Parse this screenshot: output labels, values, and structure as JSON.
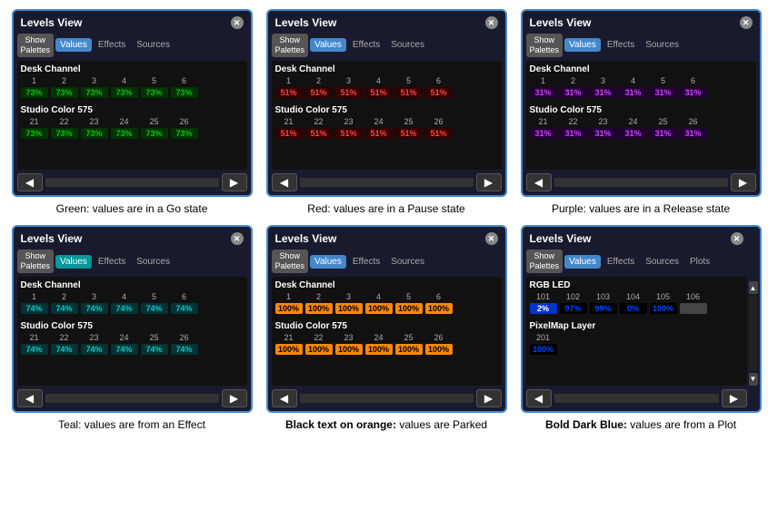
{
  "panels": [
    {
      "id": "green",
      "title": "Levels View",
      "tabs": [
        "Show Palettes",
        "Values",
        "Effects",
        "Sources"
      ],
      "activeTab": "Values",
      "sections": [
        {
          "label": "Desk Channel",
          "channels": [
            1,
            2,
            3,
            4,
            5,
            6
          ],
          "values": [
            "73%",
            "73%",
            "73%",
            "73%",
            "73%",
            "73%"
          ],
          "style": "green"
        },
        {
          "label": "Studio Color 575",
          "channels": [
            21,
            22,
            23,
            24,
            25,
            26
          ],
          "values": [
            "73%",
            "73%",
            "73%",
            "73%",
            "73%",
            "73%"
          ],
          "style": "green"
        }
      ],
      "caption": "Green: values are in a Go state",
      "captionBold": false
    },
    {
      "id": "red",
      "title": "Levels View",
      "tabs": [
        "Show Palettes",
        "Values",
        "Effects",
        "Sources"
      ],
      "activeTab": "Values",
      "sections": [
        {
          "label": "Desk Channel",
          "channels": [
            1,
            2,
            3,
            4,
            5,
            6
          ],
          "values": [
            "51%",
            "51%",
            "51%",
            "51%",
            "51%",
            "51%"
          ],
          "style": "red"
        },
        {
          "label": "Studio Color 575",
          "channels": [
            21,
            22,
            23,
            24,
            25,
            26
          ],
          "values": [
            "51%",
            "51%",
            "51%",
            "51%",
            "51%",
            "51%"
          ],
          "style": "red"
        }
      ],
      "caption": "Red: values are in a Pause state",
      "captionBold": false
    },
    {
      "id": "purple",
      "title": "Levels View",
      "tabs": [
        "Show Palettes",
        "Values",
        "Effects",
        "Sources"
      ],
      "activeTab": "Values",
      "sections": [
        {
          "label": "Desk Channel",
          "channels": [
            1,
            2,
            3,
            4,
            5,
            6
          ],
          "values": [
            "31%",
            "31%",
            "31%",
            "31%",
            "31%",
            "31%"
          ],
          "style": "purple"
        },
        {
          "label": "Studio Color 575",
          "channels": [
            21,
            22,
            23,
            24,
            25,
            26
          ],
          "values": [
            "31%",
            "31%",
            "31%",
            "31%",
            "31%",
            "31%"
          ],
          "style": "purple"
        }
      ],
      "caption": "Purple: values are in a Release state",
      "captionBold": false
    },
    {
      "id": "teal",
      "title": "Levels View",
      "tabs": [
        "Show Palettes",
        "Values",
        "Effects",
        "Sources"
      ],
      "activeTab": "Values",
      "sections": [
        {
          "label": "Desk Channel",
          "channels": [
            1,
            2,
            3,
            4,
            5,
            6
          ],
          "values": [
            "74%",
            "74%",
            "74%",
            "74%",
            "74%",
            "74%"
          ],
          "style": "teal"
        },
        {
          "label": "Studio Color 575",
          "channels": [
            21,
            22,
            23,
            24,
            25,
            26
          ],
          "values": [
            "74%",
            "74%",
            "74%",
            "74%",
            "74%",
            "74%"
          ],
          "style": "teal"
        }
      ],
      "caption": "Teal: values are from an Effect",
      "captionBold": false
    },
    {
      "id": "orange",
      "title": "Levels View",
      "tabs": [
        "Show Palettes",
        "Values",
        "Effects",
        "Sources"
      ],
      "activeTab": "Values",
      "sections": [
        {
          "label": "Desk Channel",
          "channels": [
            1,
            2,
            3,
            4,
            5,
            6
          ],
          "values": [
            "100%",
            "100%",
            "100%",
            "100%",
            "100%",
            "100%"
          ],
          "style": "orange"
        },
        {
          "label": "Studio Color 575",
          "channels": [
            21,
            22,
            23,
            24,
            25,
            26
          ],
          "values": [
            "100%",
            "100%",
            "100%",
            "100%",
            "100%",
            "100%"
          ],
          "style": "orange"
        }
      ],
      "caption": "Black text on orange: values are Parked",
      "captionBold": true
    },
    {
      "id": "plot",
      "title": "Levels View",
      "tabs": [
        "Show Palettes",
        "Values",
        "Effects",
        "Sources",
        "Plots"
      ],
      "activeTab": "Values",
      "sections": [
        {
          "label": "RGB LED",
          "channels": [
            101,
            102,
            103,
            104,
            105,
            106
          ],
          "values": [
            "2%",
            "97%",
            "99%",
            "0%",
            "100%"
          ],
          "channelCount": 5,
          "style": "plot"
        },
        {
          "label": "PixelMap Layer",
          "channels": [
            201
          ],
          "values": [
            "100%"
          ],
          "channelCount": 1,
          "style": "plot-single"
        }
      ],
      "caption": "Bold Dark Blue: values are from a Plot",
      "captionBold": true
    }
  ],
  "colors": {
    "green": "#00cc00",
    "red": "#ff4444",
    "purple": "#cc44ff",
    "teal": "#00cccc",
    "orange": "#ff8800",
    "blue": "#0044ff",
    "accent": "#4488cc"
  },
  "labels": {
    "close": "✕",
    "navLeft": "◀",
    "navRight": "▶",
    "scrollUp": "▲",
    "scrollDown": "▼"
  }
}
